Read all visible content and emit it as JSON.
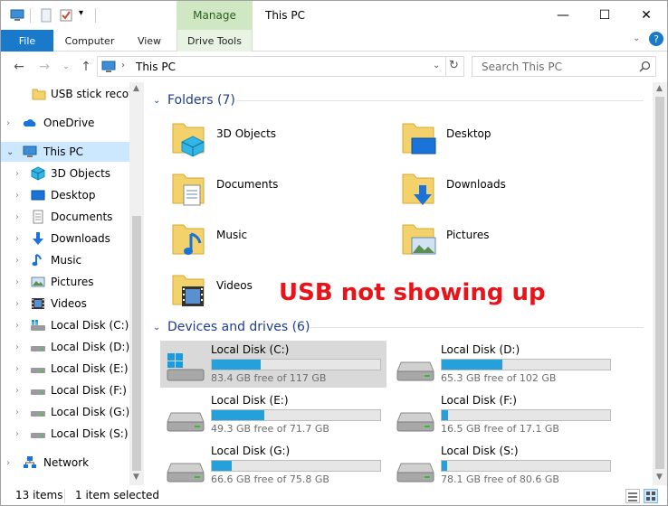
{
  "window": {
    "title": "This PC",
    "manage_tab": "Manage",
    "minimize": "—",
    "maximize": "☐",
    "close": "✕"
  },
  "ribbon": {
    "tabs": [
      "File",
      "Computer",
      "View",
      "Drive Tools"
    ],
    "help": "?"
  },
  "address": {
    "path": "This PC",
    "search_placeholder": "Search This PC"
  },
  "nav": {
    "quick_access_item": "USB stick recove",
    "items": [
      {
        "label": "OneDrive",
        "icon": "onedrive-icon"
      },
      {
        "label": "This PC",
        "icon": "computer-icon"
      },
      {
        "label": "3D Objects",
        "icon": "3d-objects-icon"
      },
      {
        "label": "Desktop",
        "icon": "desktop-icon"
      },
      {
        "label": "Documents",
        "icon": "documents-icon"
      },
      {
        "label": "Downloads",
        "icon": "downloads-icon"
      },
      {
        "label": "Music",
        "icon": "music-icon"
      },
      {
        "label": "Pictures",
        "icon": "pictures-icon"
      },
      {
        "label": "Videos",
        "icon": "videos-icon"
      },
      {
        "label": "Local Disk (C:)",
        "icon": "system-drive-icon"
      },
      {
        "label": "Local Disk (D:)",
        "icon": "drive-icon"
      },
      {
        "label": "Local Disk (E:)",
        "icon": "drive-icon"
      },
      {
        "label": "Local Disk (F:)",
        "icon": "drive-icon"
      },
      {
        "label": "Local Disk (G:)",
        "icon": "drive-icon"
      },
      {
        "label": "Local Disk (S:)",
        "icon": "drive-icon"
      },
      {
        "label": "Network",
        "icon": "network-icon"
      }
    ]
  },
  "folders": {
    "header": "Folders (7)",
    "items": [
      "3D Objects",
      "Desktop",
      "Documents",
      "Downloads",
      "Music",
      "Pictures",
      "Videos"
    ]
  },
  "drives": {
    "header": "Devices and drives (6)",
    "items": [
      {
        "name": "Local Disk (C:)",
        "free": "83.4 GB free of 117 GB",
        "used_fraction": 0.29
      },
      {
        "name": "Local Disk (D:)",
        "free": "65.3 GB free of 102 GB",
        "used_fraction": 0.36
      },
      {
        "name": "Local Disk (E:)",
        "free": "49.3 GB free of 71.7 GB",
        "used_fraction": 0.31
      },
      {
        "name": "Local Disk (F:)",
        "free": "16.5 GB free of 17.1 GB",
        "used_fraction": 0.035
      },
      {
        "name": "Local Disk (G:)",
        "free": "66.6 GB free of 75.8 GB",
        "used_fraction": 0.12
      },
      {
        "name": "Local Disk (S:)",
        "free": "78.1 GB free of 80.6 GB",
        "used_fraction": 0.03
      }
    ]
  },
  "overlay_caption": "USB not showing up",
  "status": {
    "items": "13 items",
    "selected": "1 item selected"
  },
  "colors": {
    "accent": "#1979ca",
    "selection": "#cce8ff",
    "drive_fill": "#26a0da",
    "caption": "#e8141a"
  }
}
